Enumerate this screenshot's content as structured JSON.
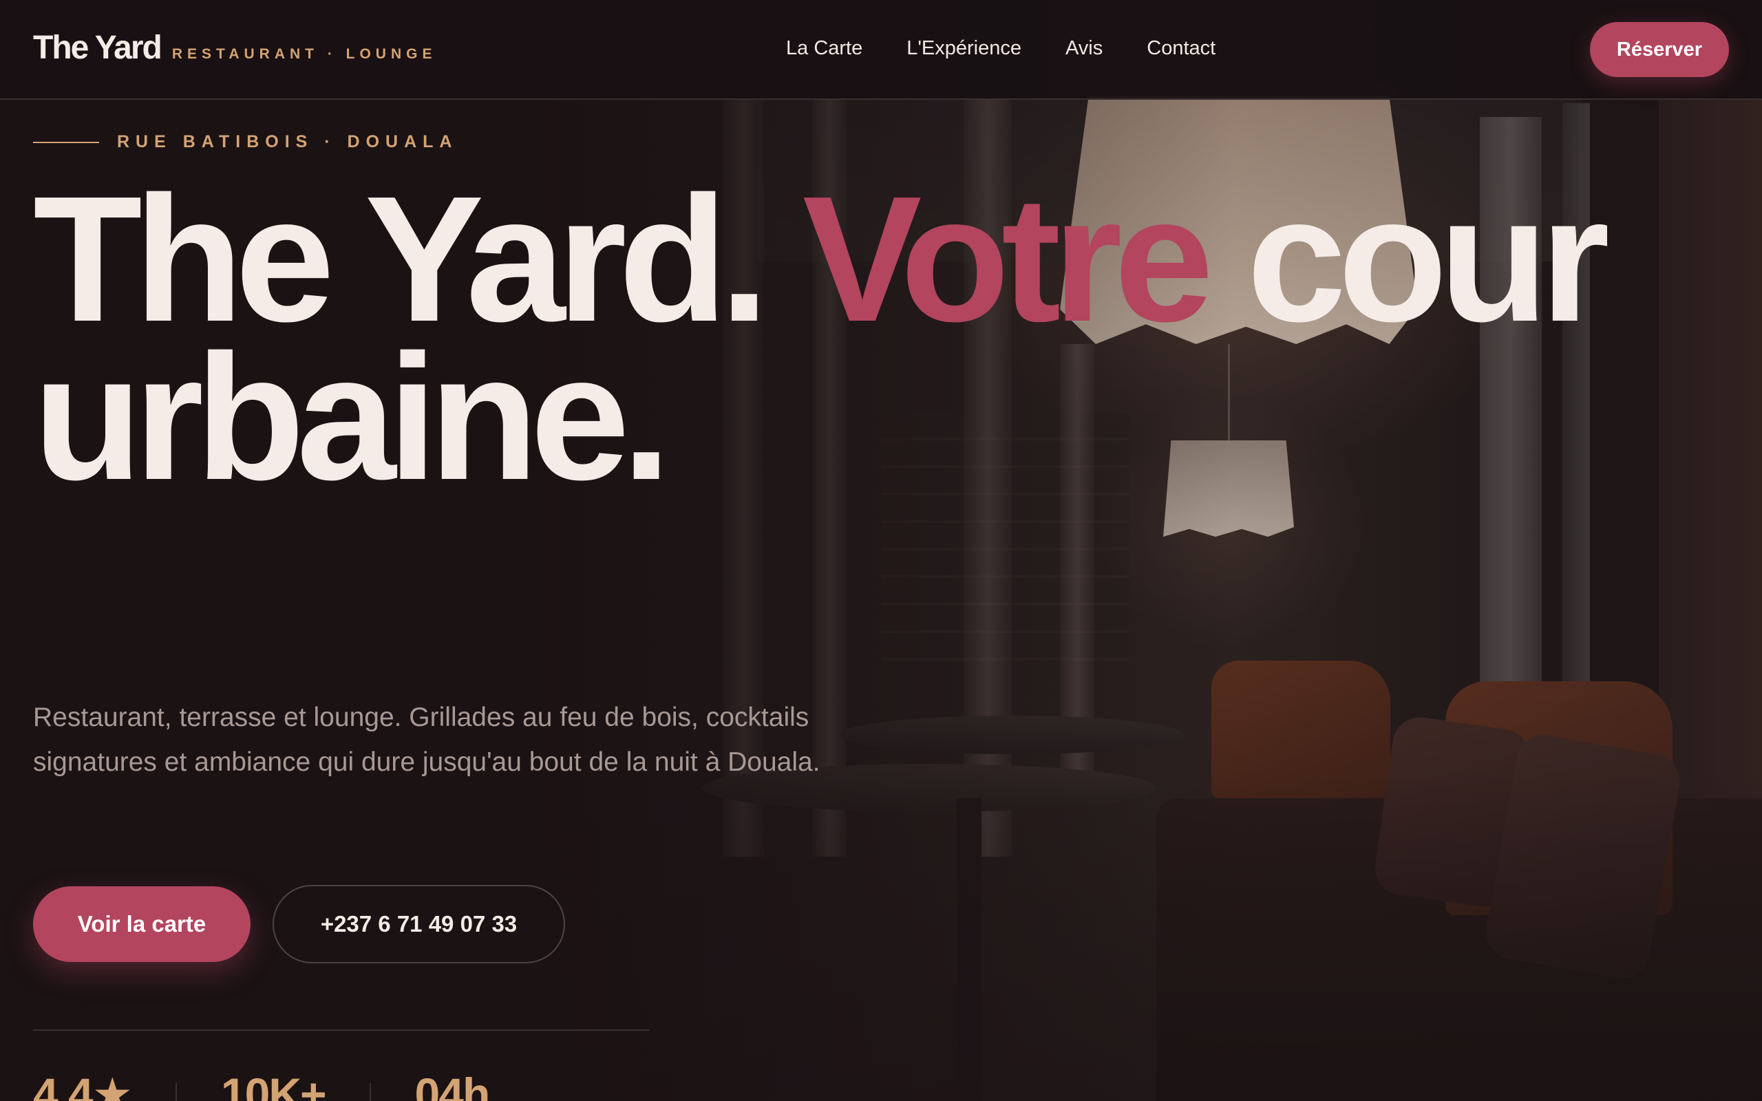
{
  "nav": {
    "brand_name": "The Yard",
    "brand_tag": "RESTAURANT · LOUNGE",
    "links": [
      "La Carte",
      "L'Expérience",
      "Avis",
      "Contact"
    ],
    "cta_label": "Réserver"
  },
  "hero": {
    "eyebrow": "RUE BATIBOIS · DOUALA",
    "headline_line1": "The Yard.",
    "headline_accent": "Votre",
    "headline_line2_rest": " cour",
    "headline_line3": "urbaine.",
    "lead": "Restaurant, terrasse et lounge. Grillades au feu de bois, cocktails signatures et ambiance qui dure jusqu'au bout de la nuit à Douala.",
    "primary_button": "Voir la carte",
    "phone_button": "+237 6 71 49 07 33"
  },
  "stats": [
    "4.4★",
    "10K+",
    "04h"
  ],
  "colors": {
    "accent": "#b3455e",
    "gold": "#d4a373",
    "background": "#1c1315",
    "text": "#f5ece7"
  }
}
